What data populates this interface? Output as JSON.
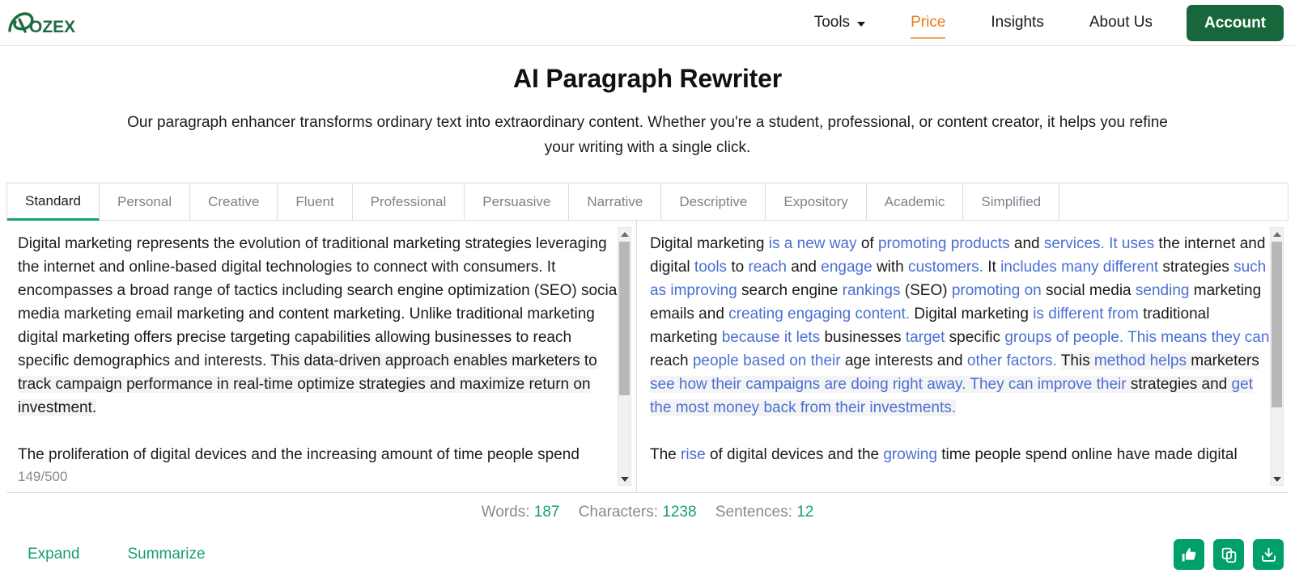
{
  "header": {
    "logo_text": "OZEX",
    "nav": [
      {
        "label": "Tools",
        "has_caret": true,
        "active": false
      },
      {
        "label": "Price",
        "has_caret": false,
        "active": true
      },
      {
        "label": "Insights",
        "has_caret": false,
        "active": false
      },
      {
        "label": "About Us",
        "has_caret": false,
        "active": false
      }
    ],
    "account_label": "Account",
    "accent_color": "#f07818",
    "brand_green": "#18673c"
  },
  "hero": {
    "title": "AI Paragraph Rewriter",
    "subtitle": "Our paragraph enhancer transforms ordinary text into extraordinary content. Whether you're a student, professional, or content creator, it helps you refine your writing with a single click."
  },
  "tabs": [
    {
      "label": "Standard",
      "active": true
    },
    {
      "label": "Personal",
      "active": false
    },
    {
      "label": "Creative",
      "active": false
    },
    {
      "label": "Fluent",
      "active": false
    },
    {
      "label": "Professional",
      "active": false
    },
    {
      "label": "Persuasive",
      "active": false
    },
    {
      "label": "Narrative",
      "active": false
    },
    {
      "label": "Descriptive",
      "active": false
    },
    {
      "label": "Expository",
      "active": false
    },
    {
      "label": "Academic",
      "active": false
    },
    {
      "label": "Simplified",
      "active": false
    }
  ],
  "input_pane": {
    "paragraph_1_plain": "Digital marketing represents the evolution of traditional marketing strategies leveraging the internet and online-based digital technologies to connect with consumers. It encompasses a broad range of tactics including search engine optimization (SEO) social media marketing email marketing and content marketing. Unlike traditional marketing digital marketing offers precise targeting capabilities allowing businesses to reach specific demographics and interests. ",
    "paragraph_1_highlighted": "This data-driven approach enables marketers to track campaign performance in real-time optimize strategies and maximize return on investment.",
    "paragraph_2": "The proliferation of digital devices and the increasing amount of time people spend online have made digital marketing essential for businesses of all sizes. It facilitates",
    "char_count": "149/500"
  },
  "output_pane": {
    "paragraph_1_segments": [
      {
        "text": "Digital marketing ",
        "changed": false,
        "highlighted": false
      },
      {
        "text": "is a new way ",
        "changed": true,
        "highlighted": false
      },
      {
        "text": "of ",
        "changed": false,
        "highlighted": false
      },
      {
        "text": "promoting products ",
        "changed": true,
        "highlighted": false
      },
      {
        "text": "and ",
        "changed": false,
        "highlighted": false
      },
      {
        "text": "services. It uses ",
        "changed": true,
        "highlighted": false
      },
      {
        "text": "the internet and digital ",
        "changed": false,
        "highlighted": false
      },
      {
        "text": "tools ",
        "changed": true,
        "highlighted": false
      },
      {
        "text": "to ",
        "changed": false,
        "highlighted": false
      },
      {
        "text": "reach ",
        "changed": true,
        "highlighted": false
      },
      {
        "text": "and ",
        "changed": false,
        "highlighted": false
      },
      {
        "text": "engage ",
        "changed": true,
        "highlighted": false
      },
      {
        "text": "with ",
        "changed": false,
        "highlighted": false
      },
      {
        "text": "customers. ",
        "changed": true,
        "highlighted": false
      },
      {
        "text": "It ",
        "changed": false,
        "highlighted": false
      },
      {
        "text": "includes many different ",
        "changed": true,
        "highlighted": false
      },
      {
        "text": "strategies ",
        "changed": false,
        "highlighted": false
      },
      {
        "text": "such as improving ",
        "changed": true,
        "highlighted": false
      },
      {
        "text": "search engine ",
        "changed": false,
        "highlighted": false
      },
      {
        "text": "rankings ",
        "changed": true,
        "highlighted": false
      },
      {
        "text": "(SEO) ",
        "changed": false,
        "highlighted": false
      },
      {
        "text": "promoting on ",
        "changed": true,
        "highlighted": false
      },
      {
        "text": "social media ",
        "changed": false,
        "highlighted": false
      },
      {
        "text": "sending ",
        "changed": true,
        "highlighted": false
      },
      {
        "text": "marketing emails and ",
        "changed": false,
        "highlighted": false
      },
      {
        "text": "creating engaging content. ",
        "changed": true,
        "highlighted": false
      },
      {
        "text": "Digital marketing ",
        "changed": false,
        "highlighted": false
      },
      {
        "text": "is different from ",
        "changed": true,
        "highlighted": false
      },
      {
        "text": "traditional marketing ",
        "changed": false,
        "highlighted": false
      },
      {
        "text": "because it lets ",
        "changed": true,
        "highlighted": false
      },
      {
        "text": "businesses ",
        "changed": false,
        "highlighted": false
      },
      {
        "text": "target ",
        "changed": true,
        "highlighted": false
      },
      {
        "text": "specific ",
        "changed": false,
        "highlighted": false
      },
      {
        "text": "groups of people. ",
        "changed": true,
        "highlighted": false
      },
      {
        "text": "This means they can ",
        "changed": true,
        "highlighted": false
      },
      {
        "text": "reach ",
        "changed": false,
        "highlighted": false
      },
      {
        "text": "people based on their ",
        "changed": true,
        "highlighted": false
      },
      {
        "text": "age interests and ",
        "changed": false,
        "highlighted": false
      },
      {
        "text": "other factors. ",
        "changed": true,
        "highlighted": false
      },
      {
        "text": "This ",
        "changed": false,
        "highlighted": true
      },
      {
        "text": "method helps ",
        "changed": true,
        "highlighted": true
      },
      {
        "text": "marketers ",
        "changed": false,
        "highlighted": true
      },
      {
        "text": "see how their campaigns are doing right away. They can improve their ",
        "changed": true,
        "highlighted": true
      },
      {
        "text": "strategies and ",
        "changed": false,
        "highlighted": true
      },
      {
        "text": "get the most money back from their investments.",
        "changed": true,
        "highlighted": true
      }
    ],
    "paragraph_2_segments": [
      {
        "text": "The ",
        "changed": false,
        "highlighted": false
      },
      {
        "text": "rise ",
        "changed": true,
        "highlighted": false
      },
      {
        "text": "of digital devices and the ",
        "changed": false,
        "highlighted": false
      },
      {
        "text": "growing ",
        "changed": true,
        "highlighted": false
      },
      {
        "text": "time people spend online have made digital",
        "changed": false,
        "highlighted": false
      }
    ]
  },
  "stats": {
    "words_label": "Words:",
    "words_value": "187",
    "characters_label": "Characters:",
    "characters_value": "1238",
    "sentences_label": "Sentences:",
    "sentences_value": "12",
    "value_color": "#17a06a"
  },
  "footer": {
    "links": [
      {
        "label": "Expand"
      },
      {
        "label": "Summarize"
      }
    ],
    "actions": [
      {
        "icon": "thumbs-up-icon"
      },
      {
        "icon": "copy-icon"
      },
      {
        "icon": "download-icon"
      }
    ],
    "button_color": "#00a06a"
  }
}
